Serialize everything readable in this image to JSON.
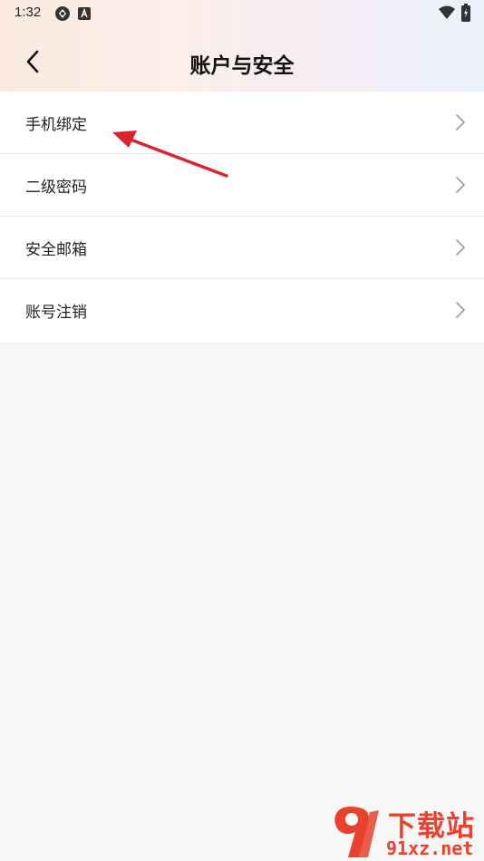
{
  "status_bar": {
    "time": "1:32",
    "icons": [
      "sync-icon",
      "a-badge-icon",
      "wifi-icon",
      "battery-icon"
    ]
  },
  "header": {
    "title": "账户与安全",
    "back_icon": "chevron-left-icon"
  },
  "menu": {
    "items": [
      {
        "label": "手机绑定",
        "icon": "chevron-right-icon"
      },
      {
        "label": "二级密码",
        "icon": "chevron-right-icon"
      },
      {
        "label": "安全邮箱",
        "icon": "chevron-right-icon"
      },
      {
        "label": "账号注销",
        "icon": "chevron-right-icon"
      }
    ]
  },
  "watermark": {
    "name": "下载站",
    "domain": "91xz.net"
  },
  "colors": {
    "annotation_arrow": "#d8262b",
    "watermark": "#e8422f",
    "page_background": "#f7f7f7"
  }
}
